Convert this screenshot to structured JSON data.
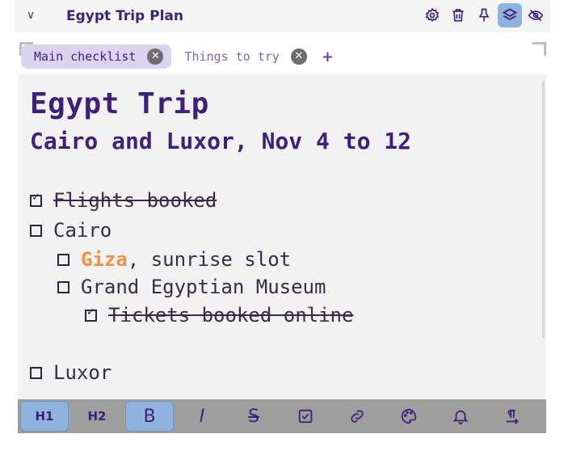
{
  "header": {
    "title": "Egypt Trip Plan",
    "collapse_icon": "chevron-down-icon",
    "icons": [
      "gear-icon",
      "trash-icon",
      "pin-icon",
      "layers-icon",
      "eye-off-icon"
    ],
    "active_icon": "layers-icon"
  },
  "tabs": [
    {
      "label": "Main checklist",
      "active": true
    },
    {
      "label": "Things to try",
      "active": false
    }
  ],
  "add_tab_label": "+",
  "document": {
    "h1": "Egypt Trip",
    "h2": "Cairo and Luxor, Nov 4 to 12",
    "items": [
      {
        "text": "Flights booked",
        "checked": true
      },
      {
        "text": "Cairo",
        "checked": false
      },
      {
        "accent": "Giza",
        "text": ", sunrise slot",
        "checked": false
      },
      {
        "text": "Grand Egyptian Museum",
        "checked": false
      },
      {
        "text": "Tickets booked online",
        "checked": true
      },
      {
        "text": "Luxor",
        "checked": false
      }
    ]
  },
  "toolbar": {
    "h1_label": "H1",
    "h2_label": "H2",
    "bold_label": "B",
    "italic_label": "I",
    "strike_label": "S",
    "icons": [
      "checkbox-icon",
      "link-icon",
      "palette-icon",
      "bell-icon",
      "paragraph-icon"
    ],
    "active": [
      "h1",
      "bold"
    ]
  },
  "colors": {
    "accent_purple": "#3f1f7a",
    "active_blue": "#8fb3dd",
    "highlight_orange": "#f59042"
  }
}
